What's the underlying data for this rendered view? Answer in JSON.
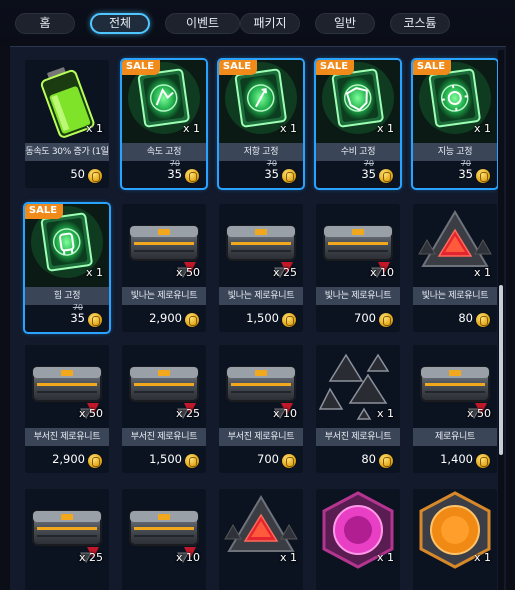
{
  "tabs": [
    {
      "label": "홈",
      "active": false
    },
    {
      "label": "전체",
      "active": true
    },
    {
      "label": "이벤트",
      "active": false
    },
    {
      "label": "패키지",
      "active": false
    },
    {
      "label": "일반",
      "active": false
    },
    {
      "label": "코스튬",
      "active": false
    }
  ],
  "sale_label": "SALE",
  "colors": {
    "accent": "#2aa2ff",
    "sale": "#f08a1b",
    "panel": "#121a2b"
  },
  "items": [
    {
      "icon": "battery-booster-icon",
      "qty": "x 1",
      "name": "동속도 30% 증가 (1일",
      "price": "50",
      "sale": false
    },
    {
      "icon": "speed-chip-book-icon",
      "qty": "x 1",
      "name": "속도 고정",
      "old_price": "70",
      "price": "35",
      "sale": true
    },
    {
      "icon": "resist-chip-book-icon",
      "qty": "x 1",
      "name": "저항 고정",
      "old_price": "70",
      "price": "35",
      "sale": true
    },
    {
      "icon": "defense-chip-book-icon",
      "qty": "x 1",
      "name": "수비 고정",
      "old_price": "70",
      "price": "35",
      "sale": true
    },
    {
      "icon": "intellect-chip-book-icon",
      "qty": "x 1",
      "name": "지능 고정",
      "old_price": "70",
      "price": "35",
      "sale": true
    },
    {
      "icon": "strength-chip-book-icon",
      "qty": "x 1",
      "name": "힘 고정",
      "old_price": "70",
      "price": "35",
      "sale": true
    },
    {
      "icon": "supply-crate-icon",
      "qty": "x 50",
      "name": "빛나는 제로유니트",
      "price": "2,900",
      "sale": false
    },
    {
      "icon": "supply-crate-icon",
      "qty": "x 25",
      "name": "빛나는 제로유니트",
      "price": "1,500",
      "sale": false
    },
    {
      "icon": "supply-crate-icon",
      "qty": "x 10",
      "name": "빛나는 제로유니트",
      "price": "700",
      "sale": false
    },
    {
      "icon": "glowing-zero-unit-icon",
      "qty": "x 1",
      "name": "빛나는 제로유니트",
      "price": "80",
      "sale": false
    },
    {
      "icon": "supply-crate-icon",
      "qty": "x 50",
      "name": "부서진 제로유니트",
      "price": "2,900",
      "sale": false
    },
    {
      "icon": "supply-crate-icon",
      "qty": "x 25",
      "name": "부서진 제로유니트",
      "price": "1,500",
      "sale": false
    },
    {
      "icon": "supply-crate-icon",
      "qty": "x 10",
      "name": "부서진 제로유니트",
      "price": "700",
      "sale": false
    },
    {
      "icon": "broken-zero-unit-icon",
      "qty": "x 1",
      "name": "부서진 제로유니트",
      "price": "80",
      "sale": false
    },
    {
      "icon": "supply-crate-icon",
      "qty": "x 50",
      "name": "제로유니트",
      "price": "1,400",
      "sale": false
    },
    {
      "icon": "supply-crate-icon",
      "qty": "x 25",
      "name": "",
      "price": "",
      "sale": false
    },
    {
      "icon": "supply-crate-icon",
      "qty": "x 10",
      "name": "",
      "price": "",
      "sale": false
    },
    {
      "icon": "zero-unit-triangle-icon",
      "qty": "x 1",
      "name": "",
      "price": "",
      "sale": false
    },
    {
      "icon": "pink-core-hexagon-icon",
      "qty": "x 1",
      "name": "",
      "price": "",
      "sale": false
    },
    {
      "icon": "orange-core-hexagon-icon",
      "qty": "x 1",
      "name": "",
      "price": "",
      "sale": false
    }
  ]
}
